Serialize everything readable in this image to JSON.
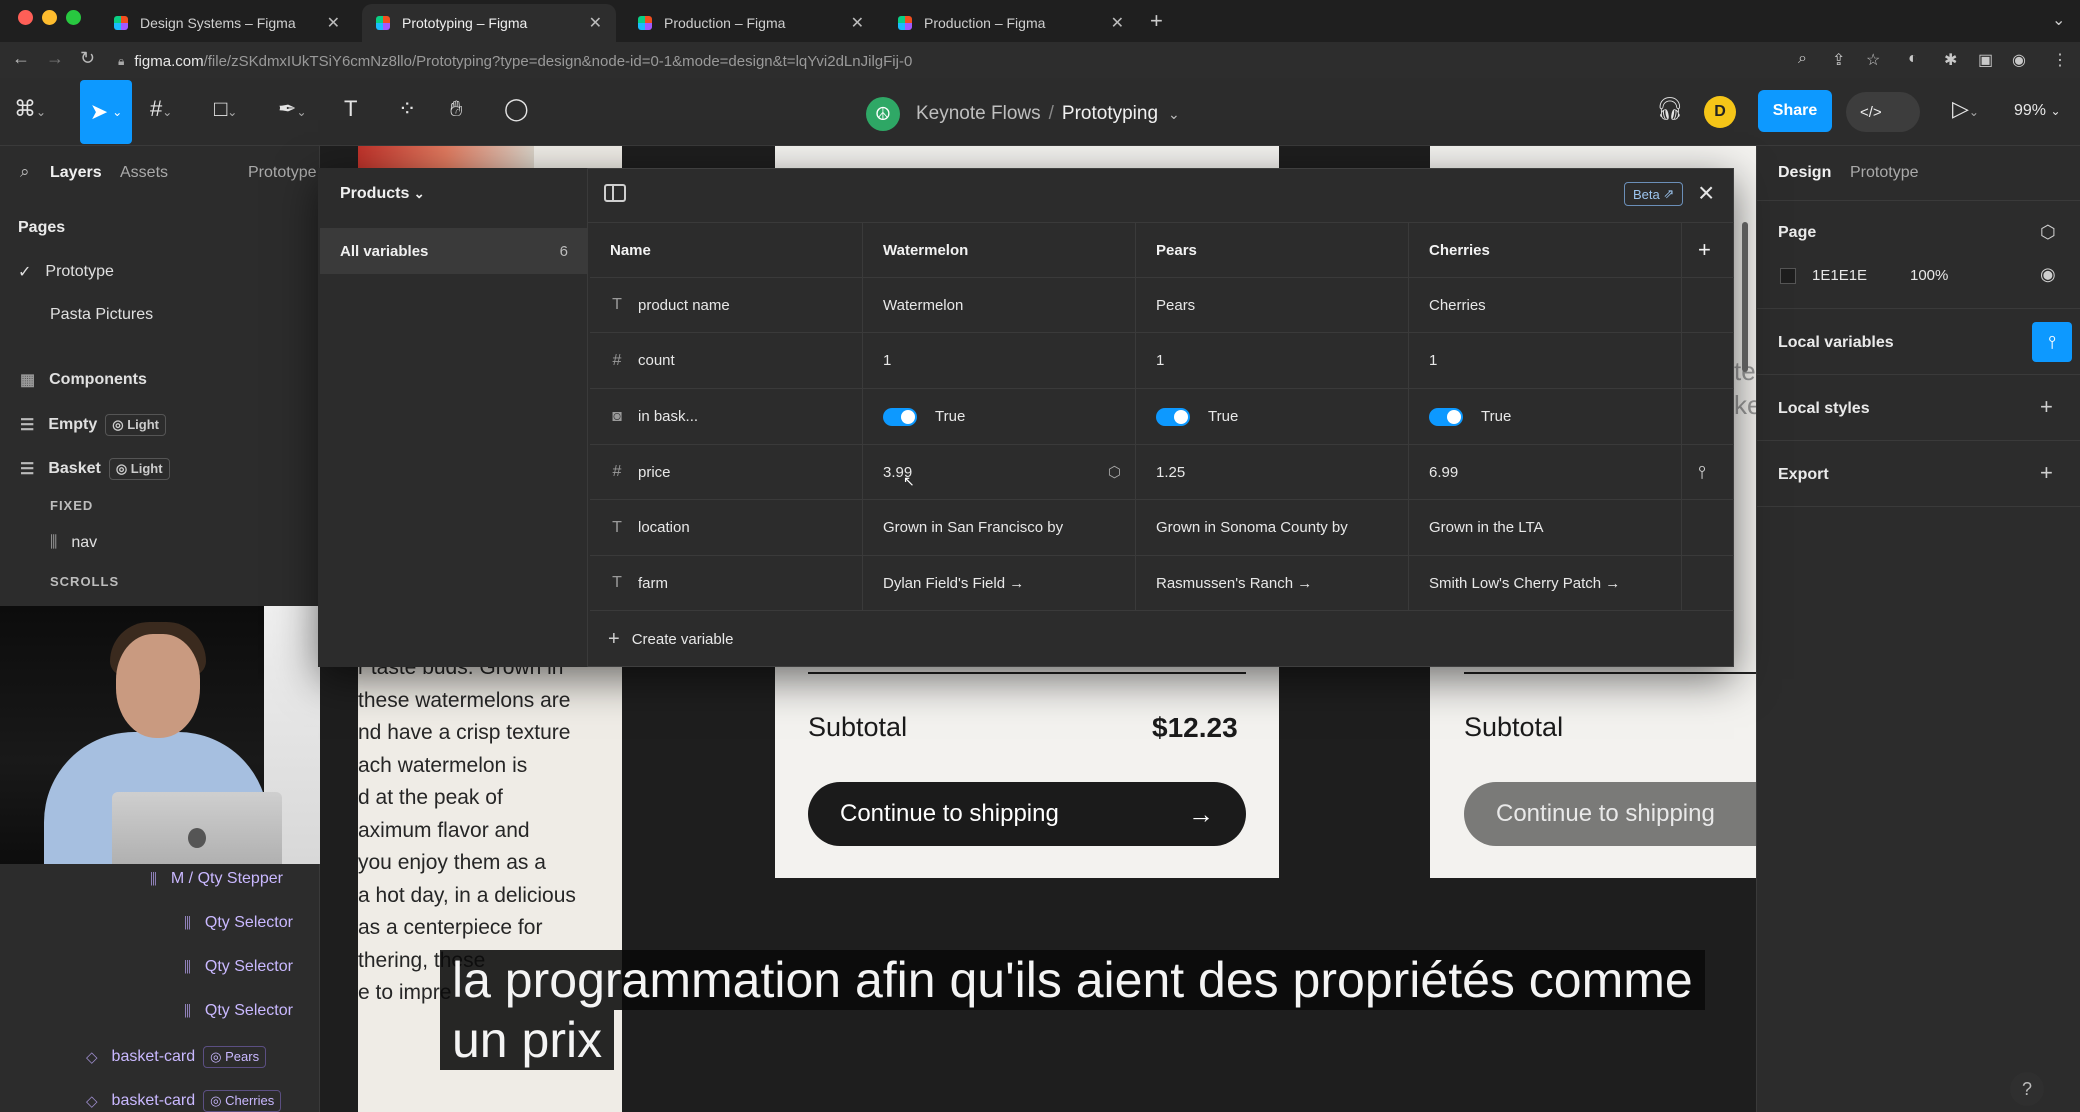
{
  "browser": {
    "tabs": [
      {
        "title": "Design Systems – Figma",
        "active": false
      },
      {
        "title": "Prototyping – Figma",
        "active": true
      },
      {
        "title": "Production – Figma",
        "active": false
      },
      {
        "title": "Production – Figma",
        "active": false
      }
    ],
    "url_host": "figma.com",
    "url_path": "/file/zSKdmxIUkTSiY6cmNz8llo/Prototyping?type=design&node-id=0-1&mode=design&t=lqYvi2dLnJilgFij-0"
  },
  "toolbar": {
    "project": "Keynote Flows",
    "file": "Prototyping",
    "avatar_initial": "D",
    "share_label": "Share",
    "zoom": "99%",
    "devmode_label": "</>"
  },
  "left_panel": {
    "tabs": [
      "Layers",
      "Assets",
      "Prototype"
    ],
    "pages_title": "Pages",
    "pages": [
      "Prototype",
      "Pasta Pictures"
    ],
    "items": [
      {
        "label": "Components"
      },
      {
        "label": "Empty",
        "chip": "Light"
      },
      {
        "label": "Basket",
        "chip": "Light"
      }
    ],
    "fixed_label": "FIXED",
    "nav_label": "nav",
    "scrolls_label": "SCROLLS",
    "layers": [
      {
        "label": "M / Qty Stepper"
      },
      {
        "label": "Qty Selector"
      },
      {
        "label": "Qty Selector"
      },
      {
        "label": "Qty Selector"
      },
      {
        "label": "basket-card",
        "chip": "Pears"
      },
      {
        "label": "basket-card",
        "chip": "Cherries"
      }
    ]
  },
  "variables_modal": {
    "collection": "Products",
    "sidebar_item": "All variables",
    "count": "6",
    "beta": "Beta",
    "columns": [
      "Name",
      "Watermelon",
      "Pears",
      "Cherries"
    ],
    "rows": [
      {
        "icon": "text-icon",
        "name": "product name",
        "values": [
          "Watermelon",
          "Pears",
          "Cherries"
        ]
      },
      {
        "icon": "number-icon",
        "name": "count",
        "values": [
          "1",
          "1",
          "1"
        ]
      },
      {
        "icon": "boolean-icon",
        "name": "in bask...",
        "values": [
          "True",
          "True",
          "True"
        ]
      },
      {
        "icon": "number-icon",
        "name": "price",
        "values": [
          "3.99",
          "1.25",
          "6.99"
        ]
      },
      {
        "icon": "text-icon",
        "name": "location",
        "values": [
          "Grown in San Francisco by",
          "Grown in Sonoma County by",
          "Grown in the LTA"
        ]
      },
      {
        "icon": "text-icon",
        "name": "farm",
        "values": [
          "Dylan Field's Field →",
          "Rasmussen's Ranch →",
          "Smith Low's Cherry Patch →"
        ]
      }
    ],
    "create_label": "Create variable"
  },
  "canvas": {
    "copy_lines": [
      "r taste buds. Grown in",
      "these watermelons are",
      "nd have a crisp texture",
      "ach watermelon is",
      "d at the peak of",
      "aximum flavor and",
      "you enjoy them as a",
      "a hot day, in a delicious",
      "as a centerpiece for",
      "thering, these",
      "e to impre"
    ],
    "subtotal_label": "Subtotal",
    "subtotal_value": "$12.23",
    "cta_label": "Continue to shipping",
    "edge_fragments": [
      "te",
      "ke"
    ]
  },
  "right_panel": {
    "tabs": [
      "Design",
      "Prototype"
    ],
    "page_title": "Page",
    "bg_hex": "1E1E1E",
    "bg_opacity": "100%",
    "local_variables": "Local variables",
    "local_styles": "Local styles",
    "export": "Export"
  },
  "subtitles": {
    "line1": "la programmation afin qu'ils aient des propriétés comme",
    "line2": "un prix"
  },
  "colors": {
    "accent": "#0d99ff",
    "panel": "#2c2c2c",
    "canvas": "#1e1e1e"
  }
}
